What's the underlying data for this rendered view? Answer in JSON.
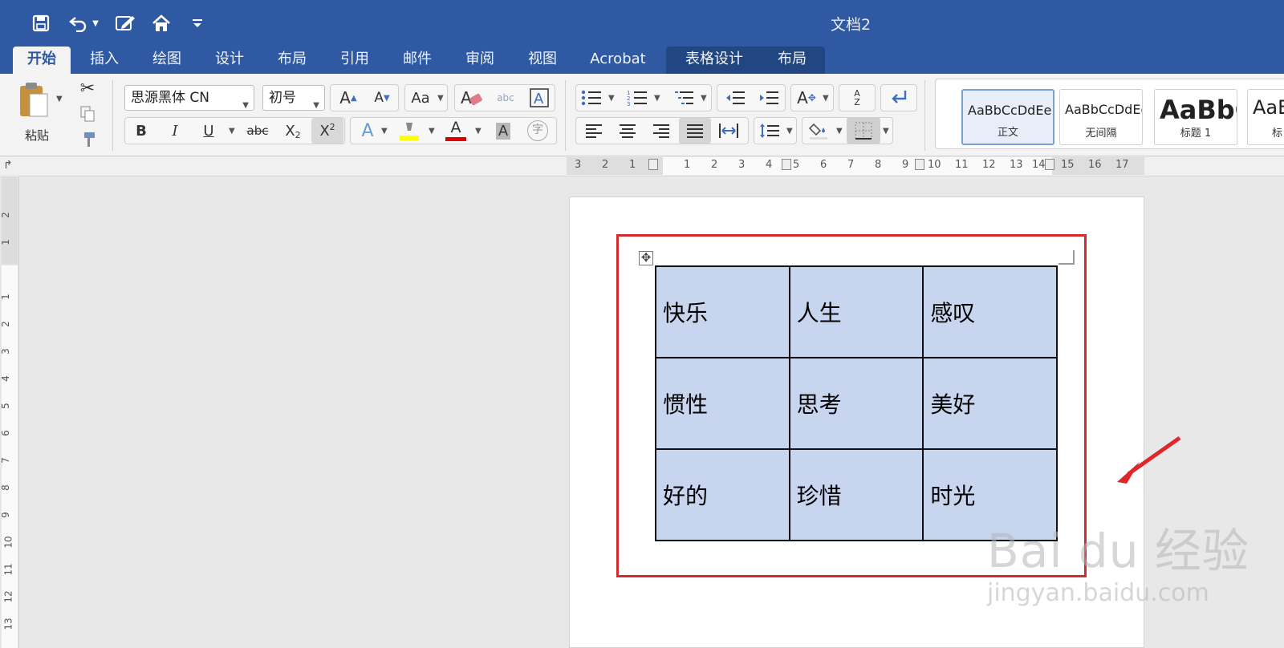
{
  "window": {
    "title": "文档2"
  },
  "tabs": [
    {
      "label": "开始",
      "active": true
    },
    {
      "label": "插入"
    },
    {
      "label": "绘图"
    },
    {
      "label": "设计"
    },
    {
      "label": "布局"
    },
    {
      "label": "引用"
    },
    {
      "label": "邮件"
    },
    {
      "label": "审阅"
    },
    {
      "label": "视图"
    },
    {
      "label": "Acrobat"
    },
    {
      "label": "表格设计"
    },
    {
      "label": "布局"
    }
  ],
  "ribbon": {
    "paste_label": "粘贴",
    "font_name": "思源黑体 CN",
    "font_size": "初号",
    "bold": "B",
    "italic": "I",
    "underline": "U",
    "strikethrough": "abc",
    "text_effect": "A",
    "font_color_letter": "A",
    "char_shading_letter": "A",
    "phonetic_letter": "字",
    "sort_letter_a": "A",
    "sort_letter_z": "Z",
    "highlight_color": "#ffff00",
    "font_color": "#e00000",
    "styles": [
      {
        "sample": "AaBbCcDdEe",
        "name": "正文",
        "selected": true
      },
      {
        "sample": "AaBbCcDdEe",
        "name": "无间隔"
      },
      {
        "sample": "AaBbC",
        "name": "标题 1"
      },
      {
        "sample": "AaBb",
        "name": "标"
      }
    ]
  },
  "ruler": {
    "h_numbers": [
      "3",
      "2",
      "1",
      "1",
      "2",
      "3",
      "4",
      "5",
      "6",
      "7",
      "8",
      "9",
      "10",
      "11",
      "12",
      "13",
      "14",
      "15",
      "16",
      "17"
    ],
    "v_numbers": [
      "2",
      "1",
      "1",
      "2",
      "3",
      "4",
      "5",
      "6",
      "7",
      "8",
      "9",
      "10",
      "11",
      "12",
      "13"
    ]
  },
  "document": {
    "table": [
      [
        "快乐",
        "人生",
        "感叹"
      ],
      [
        "惯性",
        "思考",
        "美好"
      ],
      [
        "好的",
        "珍惜",
        "时光"
      ]
    ]
  },
  "watermark": {
    "main": "Bai du 经验",
    "sub": "jingyan.baidu.com"
  },
  "colors": {
    "titlebar": "#2f5aa3",
    "cell_fill": "#c8d5ee",
    "highlight_box": "#d22d2d"
  }
}
